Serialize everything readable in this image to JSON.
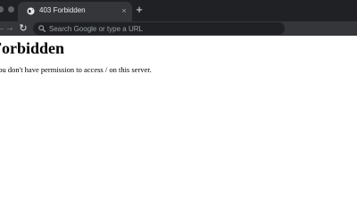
{
  "browser": {
    "tab": {
      "title": "403 Forbidden",
      "favicon_icon": "globe-icon",
      "close_label": "×"
    },
    "new_tab_label": "+",
    "nav": {
      "back_label": "←",
      "forward_label": "→",
      "reload_label": "↻"
    },
    "omnibox": {
      "placeholder": "Search Google or type a URL",
      "value": "",
      "search_icon": "search-icon"
    },
    "colors": {
      "tabstrip": "#202124",
      "active_tab": "#35363a",
      "omnibox": "#202124",
      "page_background": "#ffffff"
    }
  },
  "page": {
    "heading": "Forbidden",
    "message": "You don't have permission to access / on this server."
  }
}
